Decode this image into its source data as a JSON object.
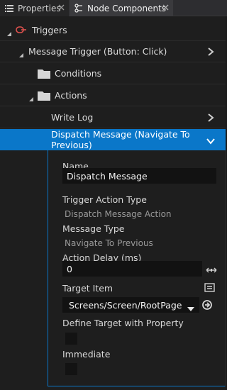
{
  "tabs": [
    {
      "label": "Properties"
    },
    {
      "label": "Node Components"
    }
  ],
  "tree": {
    "triggers": "Triggers",
    "message_trigger": "Message Trigger (Button: Click)",
    "conditions": "Conditions",
    "actions": "Actions",
    "write_log": "Write Log",
    "dispatch_message": "Dispatch Message (Navigate To Previous)"
  },
  "panel": {
    "name_label": "Name",
    "name_value": "Dispatch Message",
    "trigger_action_type_label": "Trigger Action Type",
    "trigger_action_type_value": "Dispatch Message Action",
    "message_type_label": "Message Type",
    "message_type_value": "Navigate To Previous",
    "action_delay_label": "Action Delay (ms)",
    "action_delay_value": "0",
    "target_item_label": "Target Item",
    "target_item_value": "Screens/Screen/RootPage",
    "define_target_label": "Define Target with Property",
    "immediate_label": "Immediate"
  },
  "colors": {
    "accent": "#0a77c9",
    "trigger_icon": "#e0524e"
  }
}
